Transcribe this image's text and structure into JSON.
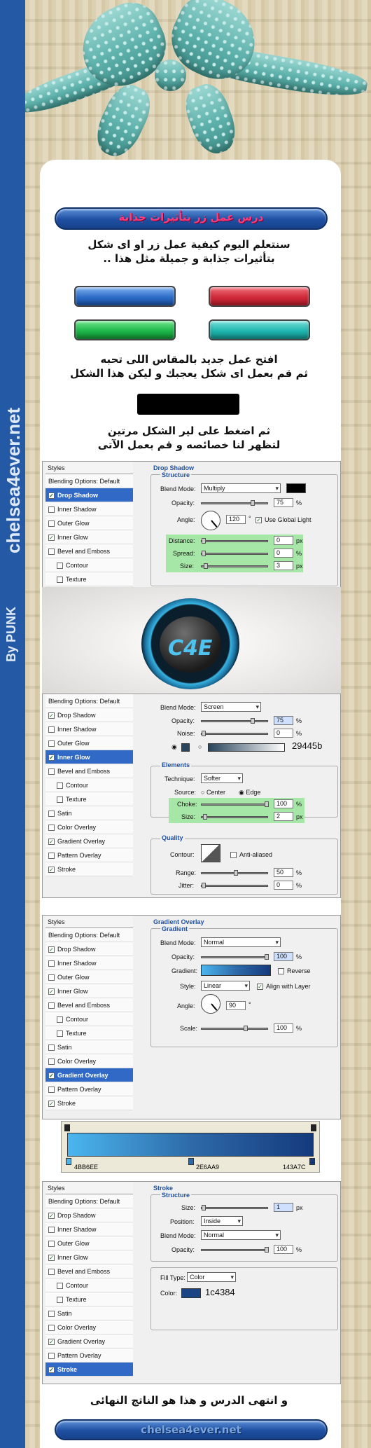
{
  "site": {
    "name": "chelsea4ever.net",
    "credit": "By PUNK"
  },
  "title": "درس عمل زر بتأثيرات جذابة",
  "intro": [
    "سنتعلم اليوم كيفية عمل زر او اى شكل",
    "بتأثيرات جذابة و جميلة مثل هذا .."
  ],
  "step1": [
    "افتح عمل جديد بالمقاس اللى تحبه",
    "ثم قم بعمل اى شكل يعجبك و ليكن هذا الشكل"
  ],
  "step2": [
    "ثم اضغط على لير الشكل مرتين",
    "لتظهر لنا خصائصه و قم بعمل الآتى"
  ],
  "ending": "و انتهى الدرس و هذا هو الناتج النهائى",
  "footer_bar": "chelsea4ever.net",
  "colors": {
    "blue": "#3a7bd5",
    "red": "#d93040",
    "green": "#1fb84a",
    "teal": "#1fb7b0"
  },
  "panel1": {
    "styles": "Styles",
    "items": [
      "Blending Options: Default",
      "Drop Shadow",
      "Inner Shadow",
      "Outer Glow",
      "Inner Glow",
      "Bevel and Emboss",
      "Contour",
      "Texture"
    ],
    "title": "Drop Shadow",
    "structure": "Structure",
    "blend_label": "Blend Mode:",
    "blend": "Multiply",
    "opacity_label": "Opacity:",
    "opacity": "75",
    "pct": "%",
    "angle_label": "Angle:",
    "angle": "120",
    "deg": "°",
    "global": "Use Global Light",
    "distance_label": "Distance:",
    "distance": "0",
    "spread_label": "Spread:",
    "spread": "0",
    "size_label": "Size:",
    "size": "3",
    "px": "px"
  },
  "panel2": {
    "items": [
      "Blending Options: Default",
      "Drop Shadow",
      "Inner Shadow",
      "Outer Glow",
      "Inner Glow",
      "Bevel and Emboss",
      "Contour",
      "Texture",
      "Satin",
      "Color Overlay",
      "Gradient Overlay",
      "Pattern Overlay",
      "Stroke"
    ],
    "blend_label": "Blend Mode:",
    "blend": "Screen",
    "opacity_label": "Opacity:",
    "opacity": "75",
    "noise_label": "Noise:",
    "noise": "0",
    "hex": "29445b",
    "elements": "Elements",
    "technique_label": "Technique:",
    "technique": "Softer",
    "source_label": "Source:",
    "center": "Center",
    "edge": "Edge",
    "choke_label": "Choke:",
    "choke": "100",
    "size_label": "Size:",
    "size": "2",
    "quality": "Quality",
    "contour_label": "Contour:",
    "anti": "Anti-aliased",
    "range_label": "Range:",
    "range": "50",
    "jitter_label": "Jitter:",
    "jitter": "0"
  },
  "panel3": {
    "styles": "Styles",
    "items": [
      "Blending Options: Default",
      "Drop Shadow",
      "Inner Shadow",
      "Outer Glow",
      "Inner Glow",
      "Bevel and Emboss",
      "Contour",
      "Texture",
      "Satin",
      "Color Overlay",
      "Gradient Overlay",
      "Pattern Overlay",
      "Stroke"
    ],
    "title": "Gradient Overlay",
    "gradient": "Gradient",
    "blend_label": "Blend Mode:",
    "blend": "Normal",
    "opacity_label": "Opacity:",
    "opacity": "100",
    "gradient_label": "Gradient:",
    "reverse": "Reverse",
    "style_label": "Style:",
    "style": "Linear",
    "align": "Align with Layer",
    "angle_label": "Angle:",
    "angle": "90",
    "scale_label": "Scale:",
    "scale": "100"
  },
  "gradient_stops": [
    "4BB6EE",
    "2E6AA9",
    "143A7C"
  ],
  "panel4": {
    "styles": "Styles",
    "items": [
      "Blending Options: Default",
      "Drop Shadow",
      "Inner Shadow",
      "Outer Glow",
      "Inner Glow",
      "Bevel and Emboss",
      "Contour",
      "Texture",
      "Satin",
      "Color Overlay",
      "Gradient Overlay",
      "Pattern Overlay",
      "Stroke"
    ],
    "title": "Stroke",
    "structure": "Structure",
    "size_label": "Size:",
    "size": "1",
    "position_label": "Position:",
    "position": "Inside",
    "blend_label": "Blend Mode:",
    "blend": "Normal",
    "opacity_label": "Opacity:",
    "opacity": "100",
    "fill_label": "Fill Type:",
    "fill": "Color",
    "color_label": "Color:",
    "hex": "1c4384"
  }
}
